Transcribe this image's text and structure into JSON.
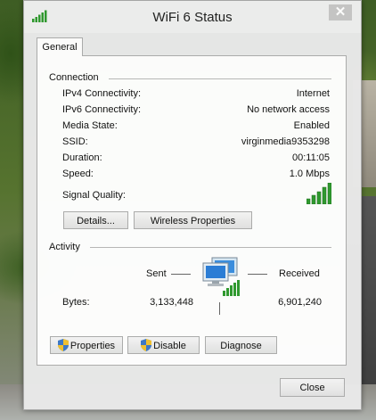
{
  "window": {
    "title": "WiFi 6 Status",
    "close_glyph": "✕"
  },
  "tabs": [
    {
      "label": "General"
    }
  ],
  "connection": {
    "section_label": "Connection",
    "rows": [
      {
        "label": "IPv4 Connectivity:",
        "value": "Internet"
      },
      {
        "label": "IPv6 Connectivity:",
        "value": "No network access"
      },
      {
        "label": "Media State:",
        "value": "Enabled"
      },
      {
        "label": "SSID:",
        "value": "virginmedia9353298"
      },
      {
        "label": "Duration:",
        "value": "00:11:05"
      },
      {
        "label": "Speed:",
        "value": "1.0 Mbps"
      }
    ],
    "signal_label": "Signal Quality:",
    "signal_bars": 5,
    "details_button": "Details...",
    "wireless_button": "Wireless Properties"
  },
  "activity": {
    "section_label": "Activity",
    "sent_label": "Sent",
    "received_label": "Received",
    "bytes_label": "Bytes:",
    "bytes_sent": "3,133,448",
    "bytes_received": "6,901,240"
  },
  "buttons": {
    "properties": "Properties",
    "disable": "Disable",
    "diagnose": "Diagnose",
    "close": "Close"
  },
  "colors": {
    "signal_green": "#2f9a2f",
    "shield_blue": "#3c78c8",
    "shield_yellow": "#f2c230"
  }
}
